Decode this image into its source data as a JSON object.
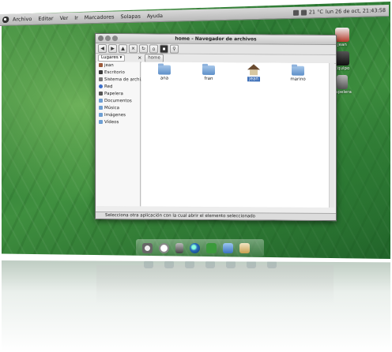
{
  "top_panel": {
    "menus": [
      "Archivo",
      "Editar",
      "Ver",
      "Ir",
      "Marcadores",
      "Solapas",
      "Ayuda"
    ],
    "temperature": "21 °C",
    "datetime": "lun 26 de oct, 21:43:58"
  },
  "desktop_icons": [
    {
      "label": "jean",
      "icon": "home-icon"
    },
    {
      "label": "Equipo",
      "icon": "computer-icon"
    },
    {
      "label": "Papelera",
      "icon": "trash-icon"
    }
  ],
  "window": {
    "title": "home - Navegador de archivos",
    "location_label": "Lugares",
    "path_button": "home",
    "sidebar": [
      {
        "label": "jean",
        "icon": "home-icon"
      },
      {
        "label": "Escritorio",
        "icon": "desktop-icon"
      },
      {
        "label": "Sistema de archi...",
        "icon": "drive-icon"
      },
      {
        "label": "Red",
        "icon": "network-icon"
      },
      {
        "label": "Papelera",
        "icon": "trash-icon"
      },
      {
        "label": "Documentos",
        "icon": "folder-icon"
      },
      {
        "label": "Música",
        "icon": "folder-icon"
      },
      {
        "label": "Imágenes",
        "icon": "folder-icon"
      },
      {
        "label": "Vídeos",
        "icon": "folder-icon"
      }
    ],
    "files": [
      {
        "label": "ana",
        "icon": "folder-icon"
      },
      {
        "label": "fran",
        "icon": "folder-icon"
      },
      {
        "label": "jean",
        "icon": "home-icon"
      },
      {
        "label": "marino",
        "icon": "folder-icon"
      }
    ],
    "status": "Selecciona otra aplicación con la cual abrir el elemento seleccionado"
  },
  "dock": [
    "settings-icon",
    "clock-icon",
    "trash-icon",
    "globe-icon",
    "recycle-icon",
    "chat-icon",
    "apps-icon"
  ],
  "colors": {
    "panel": "#c9c9c9",
    "selection": "#3d6fb8",
    "folder": "#6e9fd3"
  }
}
